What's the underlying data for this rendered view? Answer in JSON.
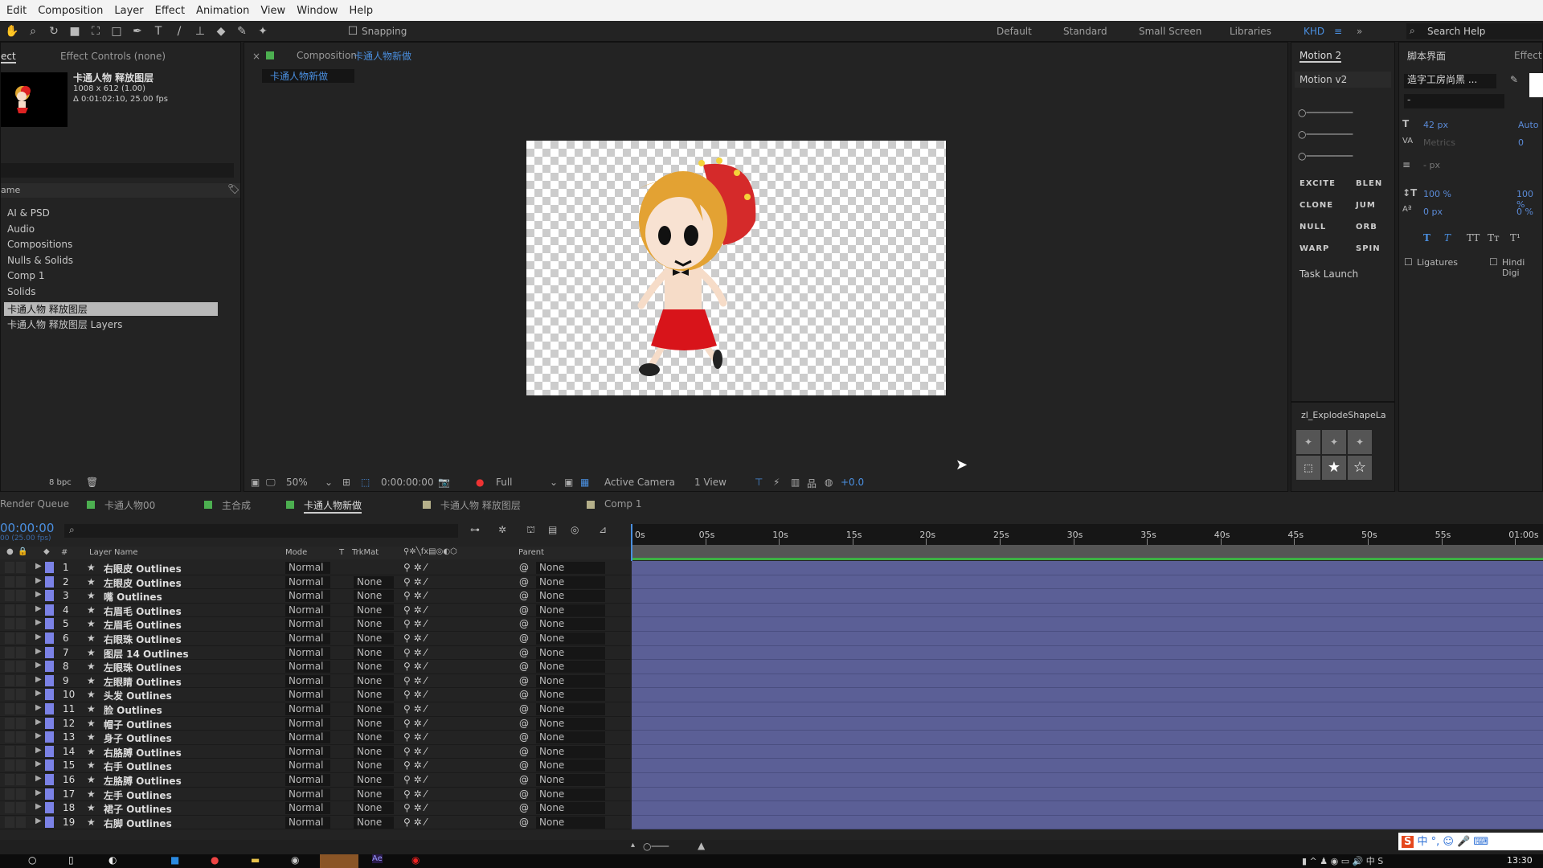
{
  "menu": [
    "Edit",
    "Composition",
    "Layer",
    "Effect",
    "Animation",
    "View",
    "Window",
    "Help"
  ],
  "toolbar": {
    "snapping": "Snapping",
    "workspaces": [
      "Default",
      "Standard",
      "Small Screen",
      "Libraries"
    ],
    "active_workspace": "KHD",
    "search_placeholder": "Search Help"
  },
  "project": {
    "tab_project": "ect",
    "tab_effect_controls": "Effect Controls (none)",
    "selected_name": "卡通人物 释放图层",
    "dimensions": "1008 x 612 (1.00)",
    "duration": "Δ 0:01:02:10, 25.00 fps",
    "column_name": "ame",
    "items": [
      "AI & PSD",
      "Audio",
      "Compositions",
      "Nulls & Solids",
      "Comp 1",
      "Solids",
      "卡通人物 释放图层",
      "卡通人物 释放图层 Layers"
    ],
    "bpc": "8 bpc"
  },
  "viewer": {
    "tab_label": "Composition",
    "comp_name": "卡通人物新做",
    "breadcrumb": "卡通人物新做",
    "zoom": "50%",
    "timecode": "0:00:00:00",
    "resolution": "Full",
    "camera": "Active Camera",
    "views": "1 View",
    "exposure": "+0.0"
  },
  "motion": {
    "tab": "Motion 2",
    "title": "Motion v2",
    "buttons": [
      "EXCITE",
      "BLEN",
      "CLONE",
      "JUM",
      "NULL",
      "ORB",
      "WARP",
      "SPIN"
    ],
    "task": "Task Launch",
    "explode_title": "zl_ExplodeShapeLa"
  },
  "character": {
    "tab_script": "脚本界面",
    "tab_effect": "Effect",
    "font": "造字工房尚黑 ...",
    "style": "-",
    "size": "42 px",
    "leading": "Auto",
    "kerning": "Metrics",
    "tracking": "0",
    "stroke": "- px",
    "vscale": "100 %",
    "hscale": "100 %",
    "baseline": "0 px",
    "tsume": "0 %",
    "ligatures": "Ligatures",
    "hindi": "Hindi Digi"
  },
  "timeline": {
    "tabs": [
      "Render Queue",
      "卡通人物00",
      "主合成",
      "卡通人物新做",
      "卡通人物 释放图层",
      "Comp 1"
    ],
    "active_tab": 3,
    "timecode": "00:00:00",
    "fps": "00 (25.00 fps)",
    "headers": {
      "name": "Layer Name",
      "mode": "Mode",
      "t": "T",
      "trkmat": "TrkMat",
      "parent": "Parent",
      "num": "#"
    },
    "ruler": [
      "0s",
      "05s",
      "10s",
      "15s",
      "20s",
      "25s",
      "30s",
      "35s",
      "40s",
      "45s",
      "50s",
      "55s",
      "01:00s"
    ],
    "layers": [
      {
        "n": "1",
        "name": "右眼皮 Outlines",
        "mode": "Normal",
        "trk": "",
        "parent": "None"
      },
      {
        "n": "2",
        "name": "左眼皮 Outlines",
        "mode": "Normal",
        "trk": "None",
        "parent": "None"
      },
      {
        "n": "3",
        "name": "嘴 Outlines",
        "mode": "Normal",
        "trk": "None",
        "parent": "None"
      },
      {
        "n": "4",
        "name": "右眉毛 Outlines",
        "mode": "Normal",
        "trk": "None",
        "parent": "None"
      },
      {
        "n": "5",
        "name": "左眉毛 Outlines",
        "mode": "Normal",
        "trk": "None",
        "parent": "None"
      },
      {
        "n": "6",
        "name": "右眼珠 Outlines",
        "mode": "Normal",
        "trk": "None",
        "parent": "None"
      },
      {
        "n": "7",
        "name": "图层 14 Outlines",
        "mode": "Normal",
        "trk": "None",
        "parent": "None"
      },
      {
        "n": "8",
        "name": "左眼珠 Outlines",
        "mode": "Normal",
        "trk": "None",
        "parent": "None"
      },
      {
        "n": "9",
        "name": "左眼睛 Outlines",
        "mode": "Normal",
        "trk": "None",
        "parent": "None"
      },
      {
        "n": "10",
        "name": "头发 Outlines",
        "mode": "Normal",
        "trk": "None",
        "parent": "None"
      },
      {
        "n": "11",
        "name": "脸 Outlines",
        "mode": "Normal",
        "trk": "None",
        "parent": "None"
      },
      {
        "n": "12",
        "name": "帽子 Outlines",
        "mode": "Normal",
        "trk": "None",
        "parent": "None"
      },
      {
        "n": "13",
        "name": "身子 Outlines",
        "mode": "Normal",
        "trk": "None",
        "parent": "None"
      },
      {
        "n": "14",
        "name": "右胳膊 Outlines",
        "mode": "Normal",
        "trk": "None",
        "parent": "None"
      },
      {
        "n": "15",
        "name": "右手 Outlines",
        "mode": "Normal",
        "trk": "None",
        "parent": "None"
      },
      {
        "n": "16",
        "name": "左胳膊 Outlines",
        "mode": "Normal",
        "trk": "None",
        "parent": "None"
      },
      {
        "n": "17",
        "name": "左手 Outlines",
        "mode": "Normal",
        "trk": "None",
        "parent": "None"
      },
      {
        "n": "18",
        "name": "裙子 Outlines",
        "mode": "Normal",
        "trk": "None",
        "parent": "None"
      },
      {
        "n": "19",
        "name": "右脚 Outlines",
        "mode": "Normal",
        "trk": "None",
        "parent": "None"
      }
    ]
  },
  "taskbar": {
    "clock": "13:30"
  },
  "colors": {
    "accent": "#4a8fe0",
    "label": "#7b82e6",
    "track": "#5b5f96",
    "workarea": "#3cb043"
  }
}
